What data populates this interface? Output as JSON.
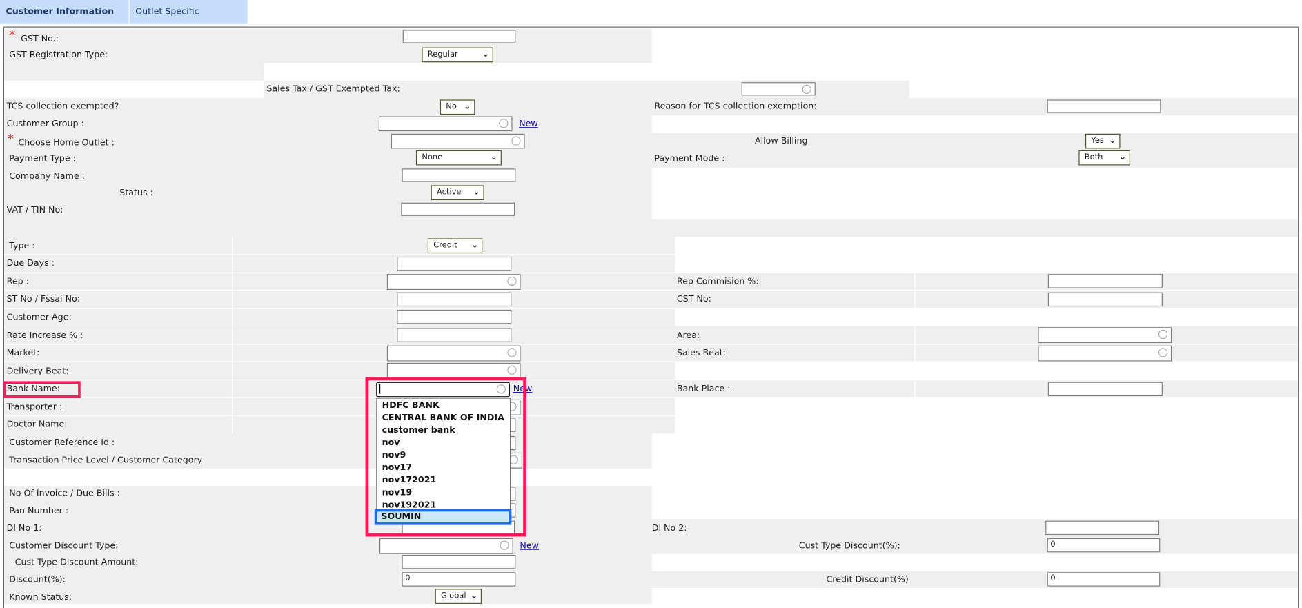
{
  "tabs": [
    {
      "label": "Customer Information",
      "active": true
    },
    {
      "label": "Outlet Specific",
      "active": false
    }
  ],
  "fields": {
    "gst_no": "GST No.:",
    "gst_reg_type": "GST Registration Type:",
    "gst_reg_type_value": "Regular",
    "sales_tax_exempt": "Sales Tax / GST Exempted Tax:",
    "tcs_exempted": "TCS collection exempted?",
    "tcs_exempted_value": "No",
    "tcs_reason": "Reason for TCS collection exemption:",
    "customer_group": "Customer Group :",
    "home_outlet": "Choose Home Outlet :",
    "allow_billing": "Allow Billing",
    "allow_billing_value": "Yes",
    "payment_type": "Payment Type :",
    "payment_type_value": "None",
    "payment_mode": "Payment Mode :",
    "payment_mode_value": "Both",
    "company_name": "Company Name :",
    "status": "Status :",
    "status_value": "Active",
    "vat_tin": "VAT / TIN No:",
    "type": "Type :",
    "type_value": "Credit",
    "due_days": "Due Days :",
    "rep": "Rep :",
    "rep_commission": "Rep Commision %:",
    "st_no": "ST No / Fssai No:",
    "cst_no": "CST No:",
    "customer_age": "Customer Age:",
    "rate_increase": "Rate Increase % :",
    "area": "Area:",
    "market": "Market:",
    "sales_beat": "Sales Beat:",
    "delivery_beat": "Delivery Beat:",
    "bank_name": "Bank Name:",
    "bank_place": "Bank Place :",
    "transporter": "Transporter :",
    "doctor_name": "Doctor Name:",
    "customer_ref": "Customer Reference Id :",
    "price_level": "Transaction Price Level / Customer Category",
    "no_invoice": "No Of Invoice / Due Bills :",
    "pan": "Pan Number :",
    "dl1": "Dl No 1:",
    "dl2": "Dl No 2:",
    "cust_discount_type": "Customer Discount Type:",
    "cust_type_discount_pct": "Cust Type Discount(%):",
    "cust_type_discount_pct_value": "0",
    "cust_type_discount_amount": "Cust Type Discount Amount:",
    "discount_pct": "Discount(%):",
    "discount_pct_value": "0",
    "credit_discount": "Credit Discount(%)",
    "credit_discount_value": "0",
    "known_status": "Known Status:",
    "known_status_value": "Global"
  },
  "required_mark": "*",
  "new_link": "New",
  "bank_dropdown": {
    "selected": "SOUMIN",
    "options": [
      "HDFC BANK",
      "CENTRAL BANK OF INDIA",
      "customer bank",
      "nov",
      "nov9",
      "nov17",
      "nov172021",
      "nov19",
      "nov192021",
      "SOUMIN"
    ]
  },
  "colors": {
    "tab_bg": "#c6dcfb",
    "row_bg": "#efefef",
    "annotation": "#ff1a5c",
    "highlight": "#1a6ff0"
  }
}
